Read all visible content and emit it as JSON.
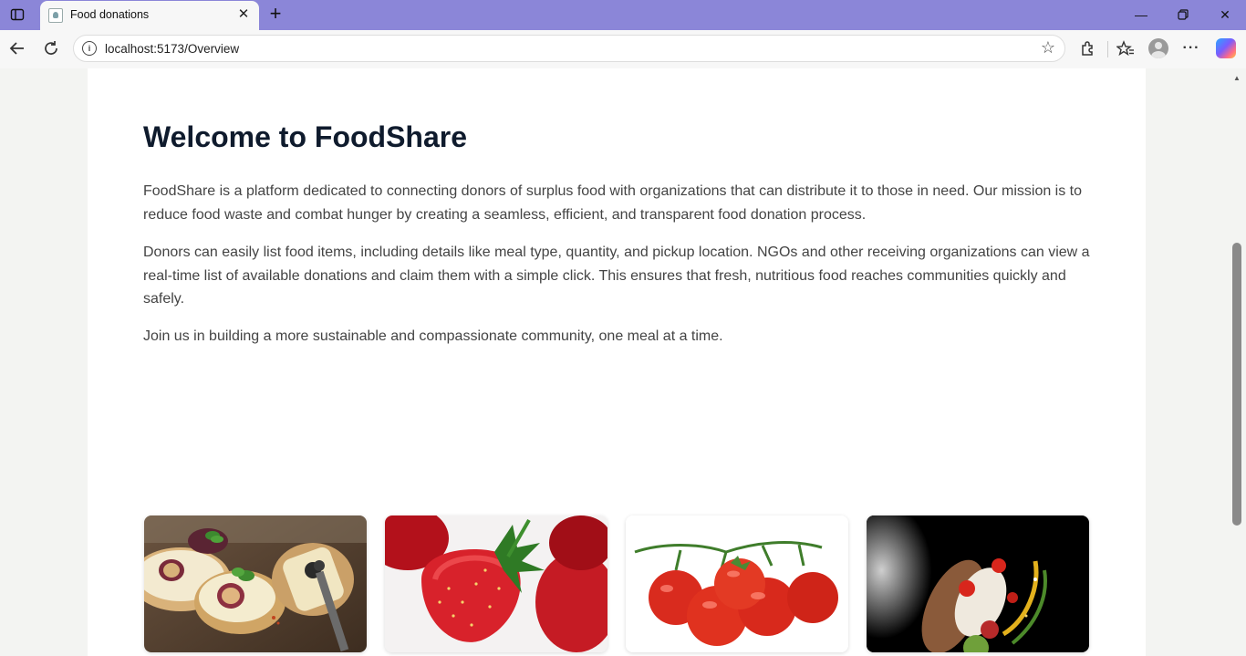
{
  "browser": {
    "tab_title": "Food donations",
    "url": "localhost:5173/Overview"
  },
  "page": {
    "heading": "Welcome to FoodShare",
    "paragraphs": [
      "FoodShare is a platform dedicated to connecting donors of surplus food with organizations that can distribute it to those in need. Our mission is to reduce food waste and combat hunger by creating a seamless, efficient, and transparent food donation process.",
      "Donors can easily list food items, including details like meal type, quantity, and pickup location. NGOs and other receiving organizations can view a real-time list of available donations and claim them with a simple click. This ensures that fresh, nutritious food reaches communities quickly and safely.",
      "Join us in building a more sustainable and compassionate community, one meal at a time."
    ],
    "gallery": [
      {
        "name": "bruschetta-figs-image"
      },
      {
        "name": "strawberries-image"
      },
      {
        "name": "cherry-tomatoes-image"
      },
      {
        "name": "sandwich-ingredients-image"
      }
    ]
  },
  "colors": {
    "titlebar": "#8b86d8",
    "heading": "#0f1b2d",
    "body_text": "#444444"
  }
}
